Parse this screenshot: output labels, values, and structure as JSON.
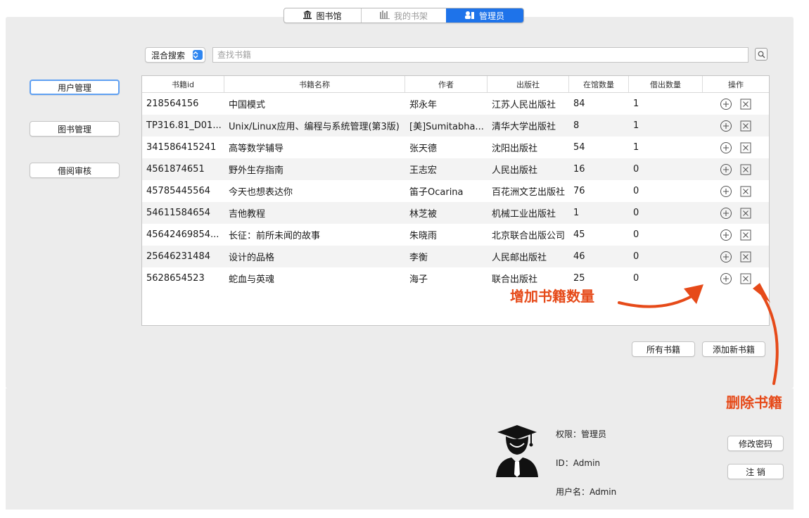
{
  "tabs": [
    {
      "label": "图书馆",
      "icon": "library-icon"
    },
    {
      "label": "我的书架",
      "icon": "bookshelf-icon"
    },
    {
      "label": "管理员",
      "icon": "admin-icon"
    }
  ],
  "search": {
    "mode": "混合搜索",
    "placeholder": "查找书籍"
  },
  "sidebar": {
    "items": [
      {
        "label": "用户管理"
      },
      {
        "label": "图书管理"
      },
      {
        "label": "借阅审核"
      }
    ]
  },
  "table": {
    "columns": [
      "书籍id",
      "书籍名称",
      "作者",
      "出版社",
      "在馆数量",
      "借出数量",
      "操作"
    ],
    "rows": [
      {
        "id": "218564156",
        "name": "中国模式",
        "author": "郑永年",
        "publisher": "江苏人民出版社",
        "stock": "84",
        "lent": "1"
      },
      {
        "id": "TP316.81_D01...",
        "name": "Unix/Linux应用、编程与系统管理(第3版)",
        "author": "[美]Sumitabha...",
        "publisher": "清华大学出版社",
        "stock": "8",
        "lent": "1"
      },
      {
        "id": "341586415241",
        "name": "高等数学辅导",
        "author": "张天德",
        "publisher": "沈阳出版社",
        "stock": "54",
        "lent": "1"
      },
      {
        "id": "4561874651",
        "name": "野外生存指南",
        "author": "王志宏",
        "publisher": "人民出版社",
        "stock": "16",
        "lent": "0"
      },
      {
        "id": "45785445564",
        "name": "今天也想表达你",
        "author": "笛子Ocarina",
        "publisher": "百花洲文艺出版社",
        "stock": "76",
        "lent": "0"
      },
      {
        "id": "54611584654",
        "name": "吉他教程",
        "author": "林芝被",
        "publisher": "机械工业出版社",
        "stock": "1",
        "lent": "0"
      },
      {
        "id": "45642469854...",
        "name": "长征：前所未闻的故事",
        "author": "朱晓雨",
        "publisher": "北京联合出版公司",
        "stock": "45",
        "lent": "0"
      },
      {
        "id": "25646231484",
        "name": "设计的品格",
        "author": "李衡",
        "publisher": "人民邮出版社",
        "stock": "46",
        "lent": "0"
      },
      {
        "id": "5628654523",
        "name": "蛇血与英魂",
        "author": "海子",
        "publisher": "联合出版社",
        "stock": "25",
        "lent": "0"
      }
    ]
  },
  "actions": {
    "all_books": "所有书籍",
    "add_book": "添加新书籍"
  },
  "annotations": {
    "increase": "增加书籍数量",
    "delete": "删除书籍"
  },
  "user": {
    "permission": "权限：管理员",
    "id": "ID：Admin",
    "username": "用户名：Admin",
    "change_password": "修改密码",
    "logout": "注 销"
  },
  "colors": {
    "accent": "#1e73ea",
    "annotation": "#e64a19"
  }
}
